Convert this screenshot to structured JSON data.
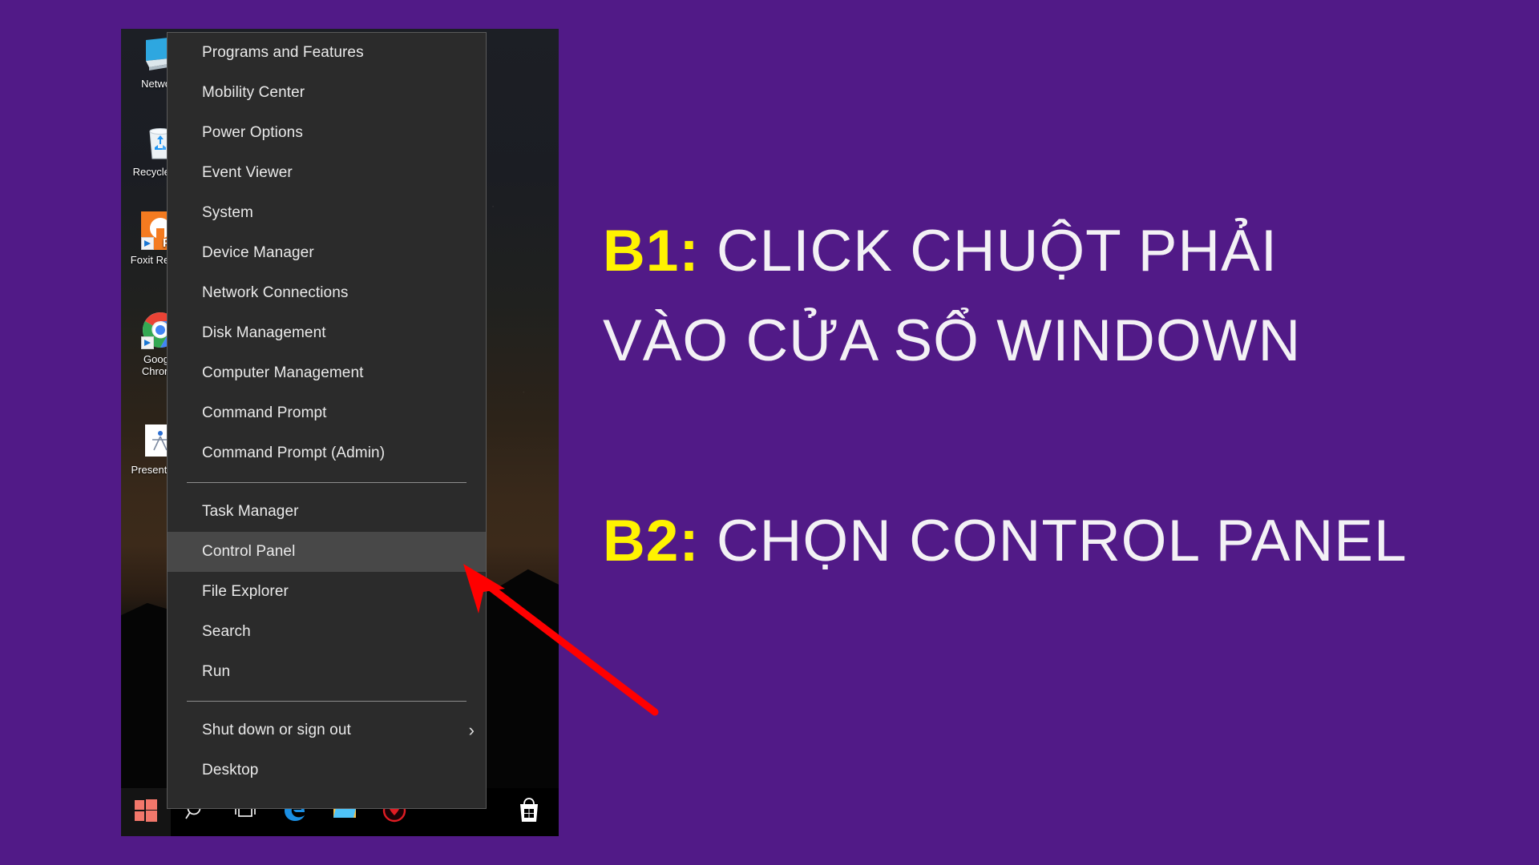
{
  "background": {
    "color": "#511A87"
  },
  "annotations": {
    "accent_color": "#FFF200",
    "text_color": "#F3F1F5",
    "arrow_color": "#FF0000",
    "steps": [
      {
        "tag": "B1:",
        "text": " CLICK CHUỘT PHẢI",
        "text_line2": "VÀO CỬA SỔ WINDOWN"
      },
      {
        "tag": "B2:",
        "text": " CHỌN CONTROL PANEL"
      }
    ]
  },
  "desktop": {
    "icons": [
      {
        "label": "Network",
        "icon": "network-computer-icon",
        "shortcut": false
      },
      {
        "label": "Recycle Bin",
        "icon": "recycle-bin-icon",
        "shortcut": false
      },
      {
        "label": "Foxit Reader",
        "icon": "foxit-reader-icon",
        "shortcut": true
      },
      {
        "label": "Google Chrome",
        "icon": "google-chrome-icon",
        "shortcut": true
      },
      {
        "label": "Presentation",
        "icon": "presentation-icon",
        "shortcut": false
      }
    ],
    "taskbar": {
      "items": [
        {
          "name": "start-button",
          "icon": "windows-logo-icon"
        },
        {
          "name": "search-button",
          "icon": "search-icon"
        },
        {
          "name": "task-view-button",
          "icon": "task-view-icon"
        },
        {
          "name": "edge-button",
          "icon": "microsoft-edge-icon"
        },
        {
          "name": "file-explorer-button",
          "icon": "file-explorer-icon"
        },
        {
          "name": "antivirus-button",
          "icon": "antivirus-shield-icon"
        },
        {
          "name": "microsoft-store-button",
          "icon": "microsoft-store-icon"
        }
      ]
    }
  },
  "context_menu": {
    "name": "windows-power-user-menu",
    "highlighted_item": "Control Panel",
    "groups": [
      {
        "items": [
          {
            "label": "Programs and Features",
            "submenu": false
          },
          {
            "label": "Mobility Center",
            "submenu": false
          },
          {
            "label": "Power Options",
            "submenu": false
          },
          {
            "label": "Event Viewer",
            "submenu": false
          },
          {
            "label": "System",
            "submenu": false
          },
          {
            "label": "Device Manager",
            "submenu": false
          },
          {
            "label": "Network Connections",
            "submenu": false
          },
          {
            "label": "Disk Management",
            "submenu": false
          },
          {
            "label": "Computer Management",
            "submenu": false
          },
          {
            "label": "Command Prompt",
            "submenu": false
          },
          {
            "label": "Command Prompt (Admin)",
            "submenu": false
          }
        ]
      },
      {
        "items": [
          {
            "label": "Task Manager",
            "submenu": false
          },
          {
            "label": "Control Panel",
            "submenu": false
          },
          {
            "label": "File Explorer",
            "submenu": false
          },
          {
            "label": "Search",
            "submenu": false
          },
          {
            "label": "Run",
            "submenu": false
          }
        ]
      },
      {
        "items": [
          {
            "label": "Shut down or sign out",
            "submenu": true,
            "chevron": "›"
          },
          {
            "label": "Desktop",
            "submenu": false
          }
        ]
      }
    ]
  }
}
